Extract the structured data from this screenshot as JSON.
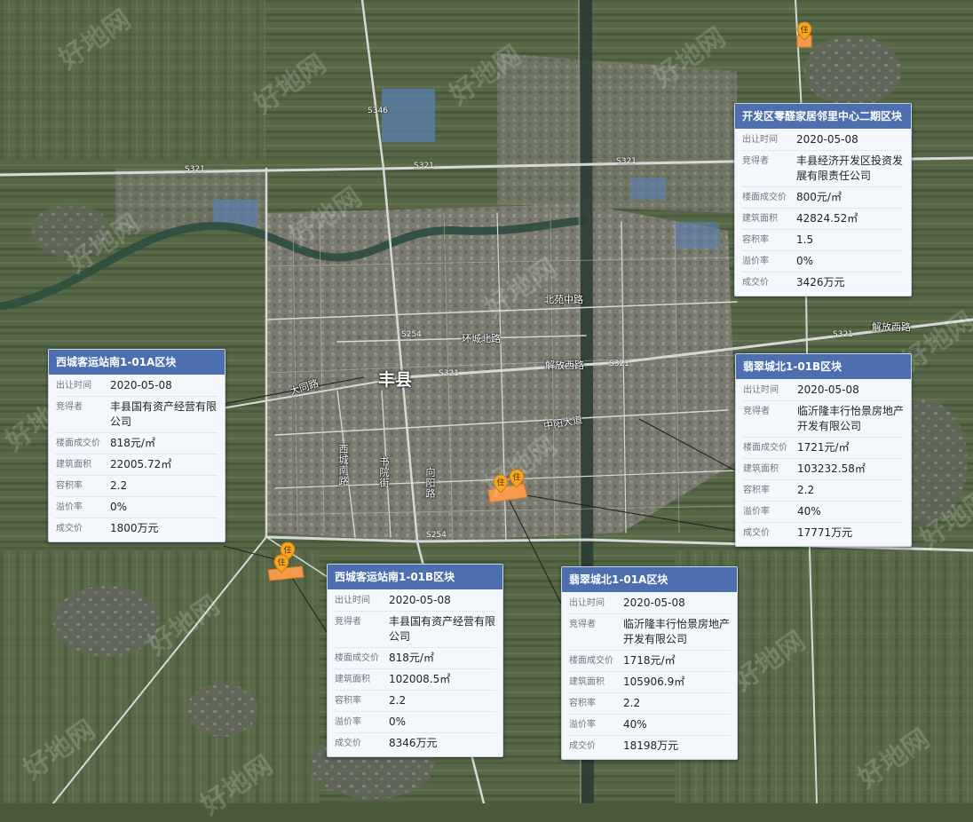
{
  "city": "丰县",
  "watermark": "好地网",
  "roads": {
    "s321_a": "S321",
    "s321_b": "S321",
    "s321_c": "S321",
    "s321_d": "S321",
    "s321_e": "S321",
    "s321_f": "S321",
    "s346": "S346",
    "s254_a": "S254",
    "s254_b": "S254",
    "beiyuan": "北苑中路",
    "huancheng": "环城北路",
    "jiefang_w": "解放西路",
    "jiefang_e": "解放西路",
    "datong": "大同路",
    "zhongyang": "中阳大道",
    "xicheng": "西城南路",
    "shuyuan": "书院街",
    "xiangyang": "向阳路"
  },
  "labels": {
    "date": "出让时间",
    "buyer": "竞得者",
    "floor_price": "楼面成交价",
    "area": "建筑面积",
    "far": "容积率",
    "premium": "溢价率",
    "price": "成交价"
  },
  "cards": [
    {
      "title": "开发区零醛家居邻里中心二期区块",
      "date": "2020-05-08",
      "buyer": "丰县经济开发区投资发展有限责任公司",
      "floor_price": "800元/㎡",
      "area": "42824.52㎡",
      "far": "1.5",
      "premium": "0%",
      "price": "3426万元"
    },
    {
      "title": "翡翠城北1-01B区块",
      "date": "2020-05-08",
      "buyer": "临沂隆丰行怡景房地产开发有限公司",
      "floor_price": "1721元/㎡",
      "area": "103232.58㎡",
      "far": "2.2",
      "premium": "40%",
      "price": "17771万元"
    },
    {
      "title": "西城客运站南1-01A区块",
      "date": "2020-05-08",
      "buyer": "丰县国有资产经营有限公司",
      "floor_price": "818元/㎡",
      "area": "22005.72㎡",
      "far": "2.2",
      "premium": "0%",
      "price": "1800万元"
    },
    {
      "title": "西城客运站南1-01B区块",
      "date": "2020-05-08",
      "buyer": "丰县国有资产经营有限公司",
      "floor_price": "818元/㎡",
      "area": "102008.5㎡",
      "far": "2.2",
      "premium": "0%",
      "price": "8346万元"
    },
    {
      "title": "翡翠城北1-01A区块",
      "date": "2020-05-08",
      "buyer": "临沂隆丰行怡景房地产开发有限公司",
      "floor_price": "1718元/㎡",
      "area": "105906.9㎡",
      "far": "2.2",
      "premium": "40%",
      "price": "18198万元"
    }
  ],
  "pin_glyph": "住",
  "colors": {
    "card_header": "#4d6faf",
    "plot": "#f39a4c",
    "pin": "#f5a623",
    "road": "#d8d8d8",
    "river": "#2f4f3f"
  }
}
